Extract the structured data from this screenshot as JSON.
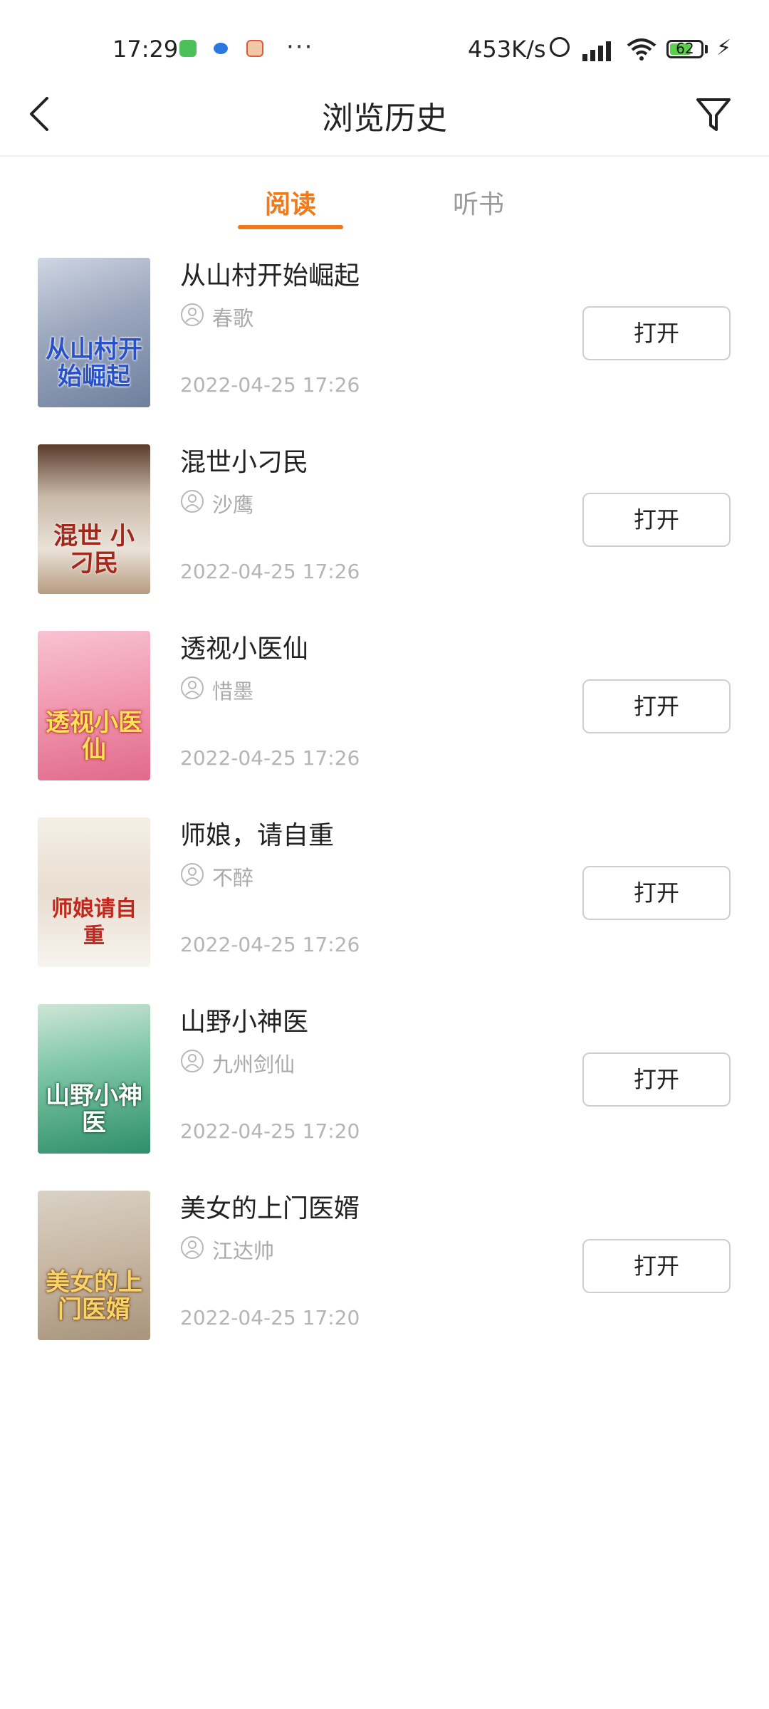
{
  "status_bar": {
    "time": "17:29",
    "more": "···",
    "net_speed": "453K/s",
    "battery": "62",
    "app_icons": [
      "wechat-style-app-icon",
      "browser-app-icon",
      "game-app-icon"
    ]
  },
  "header": {
    "title": "浏览历史",
    "back_icon": "chevron-left-icon",
    "filter_icon": "filter-funnel-icon"
  },
  "tabs": [
    {
      "label": "阅读",
      "active": true
    },
    {
      "label": "听书",
      "active": false
    }
  ],
  "colors": {
    "accent": "#f07a1a",
    "text": "#222222",
    "muted": "#aaaaaa"
  },
  "books": [
    {
      "title": "从山村开始崛起",
      "author": "春歌",
      "time": "2022-04-25 17:26",
      "button": "打开",
      "cover_text": "从山村开始崛起"
    },
    {
      "title": "混世小刁民",
      "author": "沙鹰",
      "time": "2022-04-25 17:26",
      "button": "打开",
      "cover_text": "混世 小刁民"
    },
    {
      "title": "透视小医仙",
      "author": "惜墨",
      "time": "2022-04-25 17:26",
      "button": "打开",
      "cover_text": "透视小医仙"
    },
    {
      "title": "师娘，请自重",
      "author": "不醉",
      "time": "2022-04-25 17:26",
      "button": "打开",
      "cover_text": "师娘请自重"
    },
    {
      "title": "山野小神医",
      "author": "九州剑仙",
      "time": "2022-04-25 17:20",
      "button": "打开",
      "cover_text": "山野小神医"
    },
    {
      "title": "美女的上门医婿",
      "author": "江达帅",
      "time": "2022-04-25 17:20",
      "button": "打开",
      "cover_text": "美女的上门医婿"
    }
  ]
}
